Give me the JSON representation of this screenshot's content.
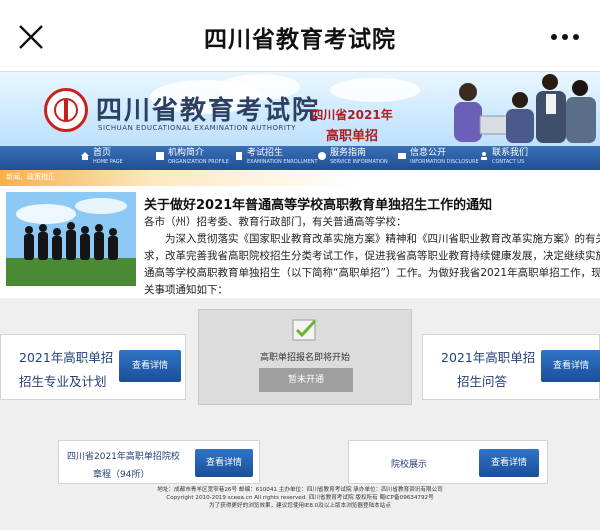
{
  "appbar": {
    "title": "四川省教育考试院"
  },
  "banner": {
    "cn_name": "四川省教育考试院",
    "en_name": "SICHUAN EDUCATIONAL EXAMINATION AUTHORITY",
    "tag_line1": "四川省2021年",
    "tag_line2": "高职单招"
  },
  "nav": {
    "items": [
      {
        "cn": "首页",
        "en": "HOME PAGE"
      },
      {
        "cn": "机构简介",
        "en": "ORGANIZATION PROFILE"
      },
      {
        "cn": "考试招生",
        "en": "EXAMINATION ENROLLMENT"
      },
      {
        "cn": "服务指南",
        "en": "SERVICE INFORMATION"
      },
      {
        "cn": "信息公开",
        "en": "INFORMATION DISCLOSURE"
      },
      {
        "cn": "联系我们",
        "en": "CONTACT US"
      }
    ]
  },
  "breadcrumb": {
    "text": "新闻、政策指正"
  },
  "article": {
    "title": "关于做好2021年普通高等学校高职教育单独招生工作的通知",
    "lines": [
      "各市（州）招考委、教育行政部门，有关普通高等学校：",
      "　　为深入贯彻落实《国家职业教育改革实施方案》精神和《四川省职业教育改革实施方案》的有关要",
      "求，改革完善我省高职院校招生分类考试工作，促进我省高等职业教育持续健康发展，决定继续实施普",
      "通高等学校高职教育单独招生（以下简称“高职单招”）工作。为做好我省2021年高职单招工作，现将有",
      "关事项通知如下："
    ]
  },
  "cards": {
    "left_top_line1": "2021年高职单招",
    "left_top_line2": "招生专业及计划",
    "right_top_line1": "2021年高职单招",
    "right_top_line2": "招生问答",
    "bottom_left_line1": "四川省2021年高职单招院校",
    "bottom_left_line2": "章程（94所）",
    "bottom_right": "院校展示",
    "view_label": "查看详情"
  },
  "center_panel": {
    "text": "高职单招报名即将开始",
    "button": "暂未开通"
  },
  "footer": {
    "line1": "地址：成都市青羊区宽窄巷26号 邮编：610041 主办单位：四川省教育考试院 承办单位：四川省教育资讯有限公司",
    "line2": "Copyright 2010-2019 sceea.cn All rights reserved. 四川省教育考试院 版权所有 蜀ICP备09634792号",
    "line3": "为了获得更好的浏览效果，建议您使用IE8.0及以上版本浏览器登陆本站点"
  },
  "colors": {
    "accent_blue": "#1f4f95",
    "brand_red": "#c8201c",
    "card_text": "#24407a"
  }
}
